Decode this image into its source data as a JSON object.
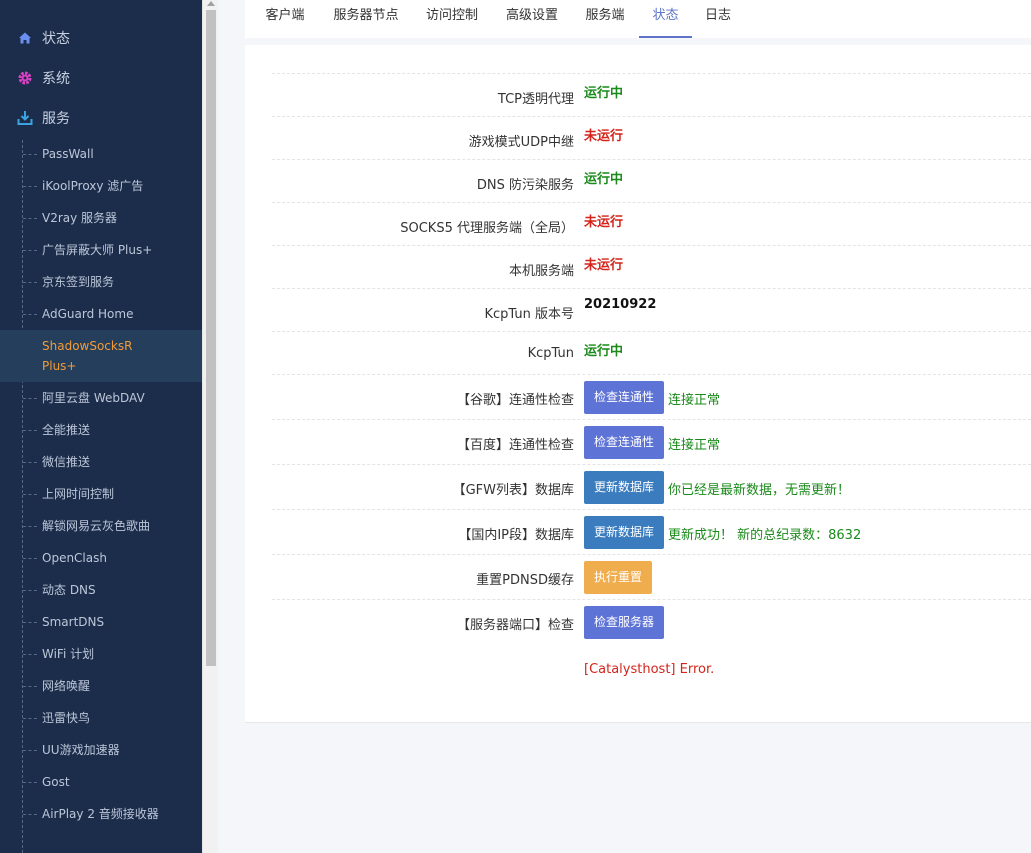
{
  "sidebar": {
    "top": [
      {
        "label": "状态",
        "icon": "home-icon"
      },
      {
        "label": "系统",
        "icon": "gear-icon"
      },
      {
        "label": "服务",
        "icon": "download-icon"
      }
    ],
    "items": [
      {
        "label": "PassWall"
      },
      {
        "label": "iKoolProxy 滤广告"
      },
      {
        "label": "V2ray 服务器"
      },
      {
        "label": "广告屏蔽大师 Plus+"
      },
      {
        "label": "京东签到服务"
      },
      {
        "label": "AdGuard Home"
      },
      {
        "label": "ShadowSocksR Plus+",
        "active": true
      },
      {
        "label": "阿里云盘 WebDAV"
      },
      {
        "label": "全能推送"
      },
      {
        "label": "微信推送"
      },
      {
        "label": "上网时间控制"
      },
      {
        "label": "解锁网易云灰色歌曲"
      },
      {
        "label": "OpenClash"
      },
      {
        "label": "动态 DNS"
      },
      {
        "label": "SmartDNS"
      },
      {
        "label": "WiFi 计划"
      },
      {
        "label": "网络唤醒"
      },
      {
        "label": "迅雷快鸟"
      },
      {
        "label": "UU游戏加速器"
      },
      {
        "label": "Gost"
      },
      {
        "label": "AirPlay 2 音频接收器"
      }
    ]
  },
  "tabs": [
    "客户端",
    "服务器节点",
    "访问控制",
    "高级设置",
    "服务端",
    "状态",
    "日志"
  ],
  "active_tab": "状态",
  "status": {
    "tcp": {
      "label": "TCP透明代理",
      "value": "运行中"
    },
    "udp": {
      "label": "游戏模式UDP中继",
      "value": "未运行"
    },
    "dns": {
      "label": "DNS 防污染服务",
      "value": "运行中"
    },
    "socks5": {
      "label": "SOCKS5 代理服务端（全局）",
      "value": "未运行"
    },
    "local": {
      "label": "本机服务端",
      "value": "未运行"
    },
    "kcp_version": {
      "label": "KcpTun 版本号",
      "value": "20210922"
    },
    "kcp": {
      "label": "KcpTun",
      "value": "运行中"
    }
  },
  "checks": {
    "google": {
      "label": "【谷歌】连通性检查",
      "button": "检查连通性",
      "result": "连接正常"
    },
    "baidu": {
      "label": "【百度】连通性检查",
      "button": "检查连通性",
      "result": "连接正常"
    },
    "gfw": {
      "label": "【GFW列表】数据库",
      "button": "更新数据库",
      "result": "你已经是最新数据，无需更新！"
    },
    "chnip": {
      "label": "【国内IP段】数据库",
      "button": "更新数据库",
      "result": "更新成功！ 新的总纪录数：8632"
    },
    "pdnsd": {
      "label": "重置PDNSD缓存",
      "button": "执行重置"
    },
    "port": {
      "label": "【服务器端口】检查",
      "button": "检查服务器"
    }
  },
  "error": "[Catalysthost] Error.",
  "colors": {
    "sidebar_bg": "#1c2d4b",
    "accent": "#5c73c8",
    "running": "#1a8a1a",
    "stopped": "#d4241b",
    "active_menu": "#f29c38"
  }
}
